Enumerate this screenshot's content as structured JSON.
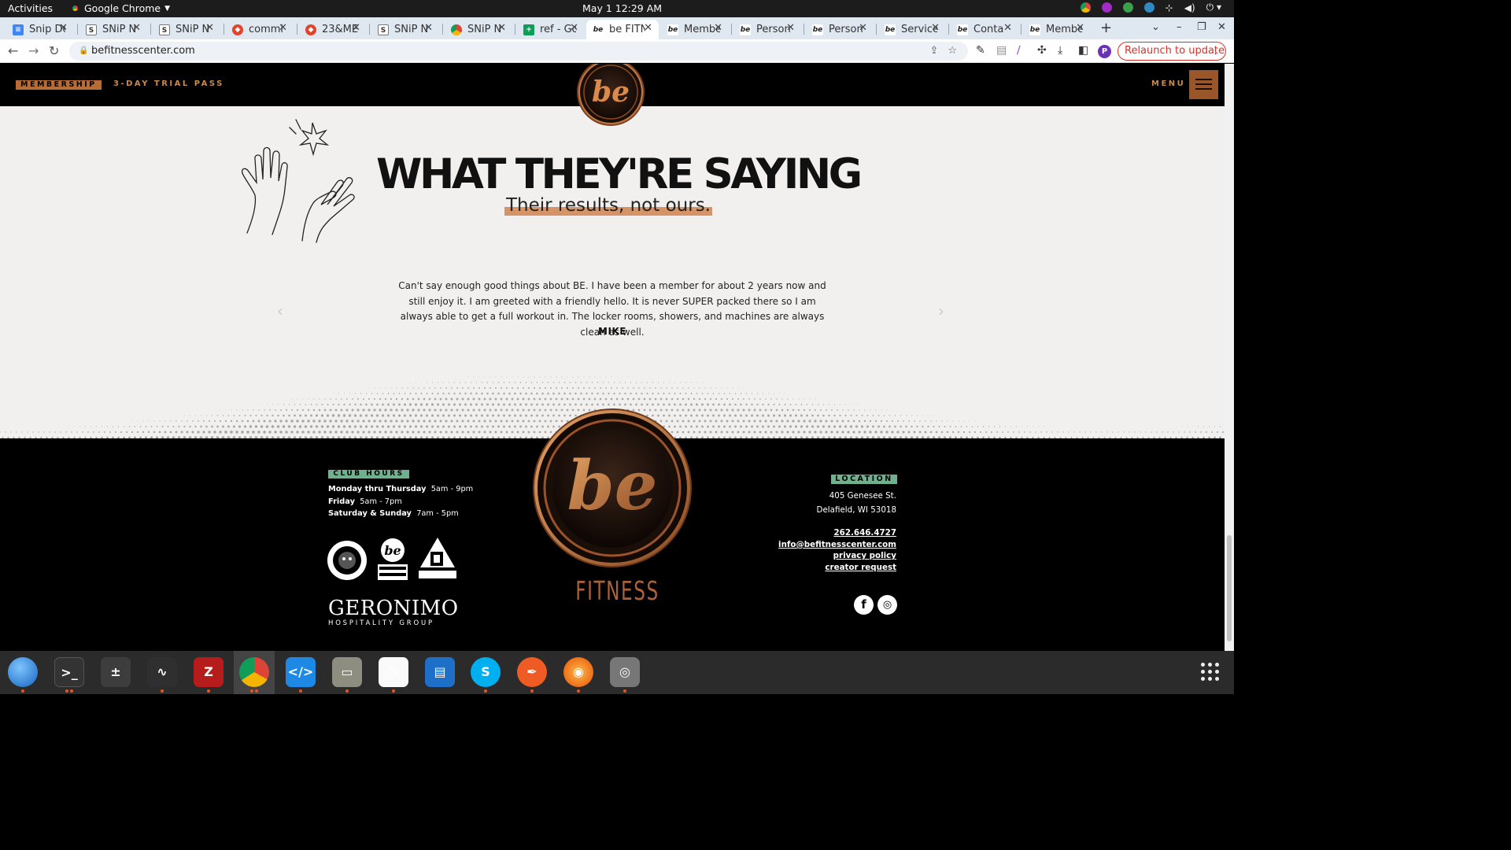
{
  "system": {
    "activities": "Activities",
    "app_name": "Google Chrome",
    "clock": "May 1  12:29 AM"
  },
  "browser": {
    "tabs": [
      {
        "title": "Snip De",
        "icon": "docs-icon"
      },
      {
        "title": "SNiP N",
        "icon": "snip-icon"
      },
      {
        "title": "SNiP N",
        "icon": "snip-icon"
      },
      {
        "title": "commi",
        "icon": "gitlab-icon"
      },
      {
        "title": "23&ME",
        "icon": "gitlab-icon"
      },
      {
        "title": "SNiP N",
        "icon": "snip-icon"
      },
      {
        "title": "SNiP N",
        "icon": "chrome-icon"
      },
      {
        "title": "ref - Go",
        "icon": "sheets-icon"
      },
      {
        "title": "be FITN",
        "icon": "be-icon",
        "active": true
      },
      {
        "title": "Membe",
        "icon": "be-icon"
      },
      {
        "title": "Person",
        "icon": "be-icon"
      },
      {
        "title": "Person",
        "icon": "be-icon"
      },
      {
        "title": "Service",
        "icon": "be-icon"
      },
      {
        "title": "Conta",
        "icon": "be-icon"
      },
      {
        "title": "Membe",
        "icon": "be-icon"
      }
    ],
    "url": "befitnesscenter.com",
    "profile_initial": "P",
    "relaunch_label": "Relaunch to update"
  },
  "site": {
    "header": {
      "membership_label": "MEMBERSHIP",
      "trial_label": "3-DAY TRIAL PASS",
      "menu_label": "MENU",
      "logo_text": "be"
    },
    "testimonials": {
      "heading": "WHAT THEY'RE SAYING",
      "subheading": "Their results, not ours.",
      "quote": "Can't say enough good things about BE. I have been a member for about 2 years now and still enjoy it. I am greeted with a friendly hello. It is never SUPER packed there so I am always able to get a full workout in. The locker rooms, showers, and machines are always clean as well.",
      "author": "MIKE"
    },
    "footer": {
      "hours_label": "CLUB HOURS",
      "hours": [
        {
          "days": "Monday thru Thursday",
          "time": "5am - 9pm"
        },
        {
          "days": "Friday",
          "time": "5am - 7pm"
        },
        {
          "days": "Saturday & Sunday",
          "time": "7am - 5pm"
        }
      ],
      "brands": [
        "BARK RIVER CROSSFIT",
        "be SPORTS PERFORMANCE",
        "REFUGE"
      ],
      "group_name": "GERONIMO",
      "group_sub": "HOSPITALITY GROUP",
      "logo_text": "be",
      "logo_word": "FITNESS",
      "location_label": "LOCATION",
      "address_line1": "405 Genesee St.",
      "address_line2": "Delafield, WI 53018",
      "phone": "262.646.4727",
      "email": "info@befitnesscenter.com",
      "privacy": "privacy policy",
      "creator": "creator request",
      "social": [
        "facebook-icon",
        "instagram-icon"
      ]
    }
  },
  "colors": {
    "accent_copper": "#b86c35",
    "label_green": "#6fb08e",
    "highlight": "#d49467"
  },
  "dock": [
    "thunderbird-icon",
    "terminal-icon",
    "calculator-icon",
    "system-monitor-icon",
    "filezilla-icon",
    "chrome-icon",
    "vscode-icon",
    "files-icon",
    "text-editor-icon",
    "libreoffice-writer-icon",
    "skype-icon",
    "postman-icon",
    "blender-icon",
    "disks-icon"
  ]
}
